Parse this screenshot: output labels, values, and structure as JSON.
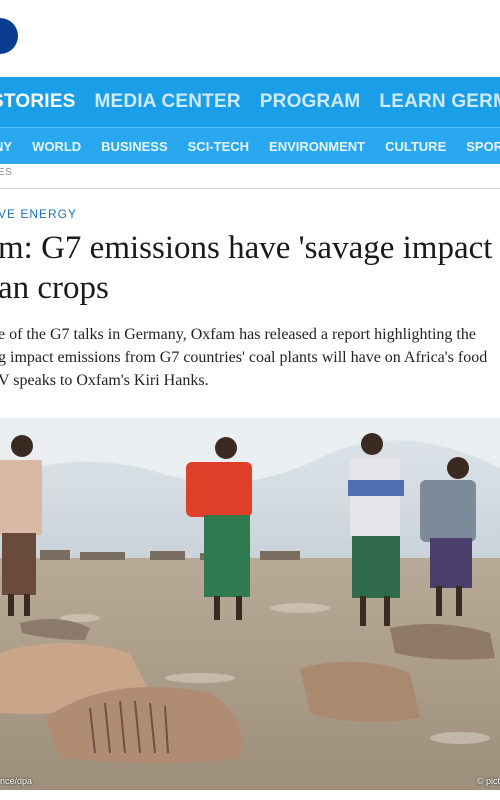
{
  "nav_main": [
    {
      "label": "STORIES",
      "active": true
    },
    {
      "label": "MEDIA CENTER",
      "active": false
    },
    {
      "label": "PROGRAM",
      "active": false
    },
    {
      "label": "LEARN GERMAN",
      "active": false
    }
  ],
  "nav_sub": [
    "NY",
    "WORLD",
    "BUSINESS",
    "SCI-TECH",
    "ENVIRONMENT",
    "CULTURE",
    "SPORTS"
  ],
  "breadcrumb": "ES",
  "kicker": "VE ENERGY",
  "headline": {
    "line1": "m: G7 emissions have 'savage impact",
    "line2": "an crops"
  },
  "lead": {
    "line1": "e of the G7 talks in Germany, Oxfam has released a report highlighting the",
    "line2": "g impact emissions from G7 countries' coal plants will have on Africa's food",
    "line3": "V speaks to Oxfam's Kiri Hanks."
  },
  "photo": {
    "credit_left": "nce/dpa",
    "credit_right": "© pict"
  },
  "colors": {
    "nav_main": "#1a9ee8",
    "nav_sub": "#2aa8ef",
    "kicker": "#1d6fb8",
    "logo": "#0a3d8f"
  },
  "icons": {
    "logo": "dw-logo-circle"
  }
}
